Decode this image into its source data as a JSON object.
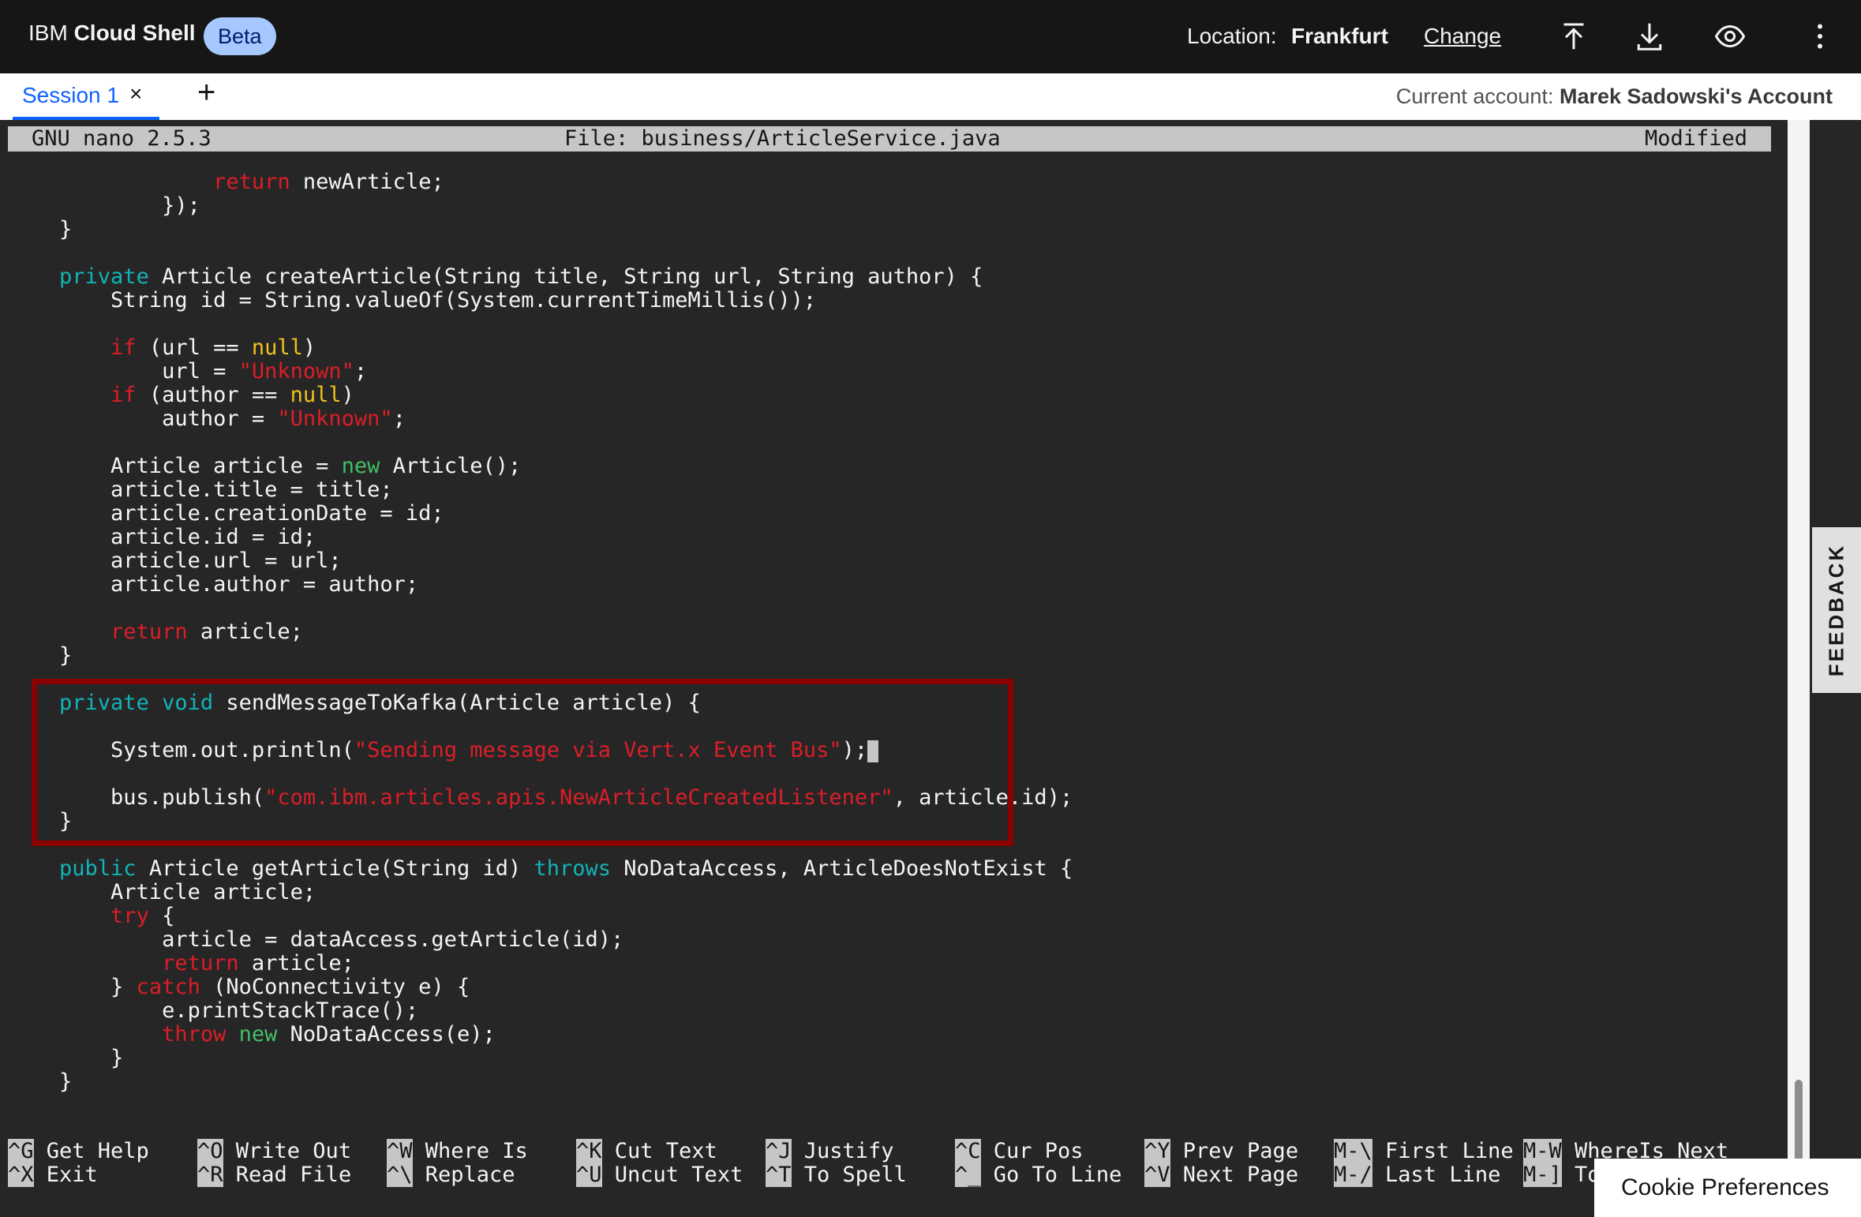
{
  "header": {
    "brand_prefix": "IBM",
    "brand_name": "Cloud Shell",
    "beta_badge": "Beta",
    "location_label": "Location:",
    "location_value": "Frankfurt",
    "change_link": "Change",
    "icons": [
      "upload-icon",
      "download-icon",
      "preview-eye-icon",
      "overflow-menu-icon"
    ]
  },
  "tabs": {
    "session_label": "Session 1",
    "close_glyph": "×",
    "add_glyph": "+",
    "account_label": "Current account:",
    "account_name": "Marek Sadowski's Account"
  },
  "nano": {
    "version": "GNU nano 2.5.3",
    "file": "File: business/ArticleService.java",
    "status": "Modified"
  },
  "code_lines": [
    "                return newArticle;",
    "            });",
    "    }",
    "",
    "    private Article createArticle(String title, String url, String author) {",
    "        String id = String.valueOf(System.currentTimeMillis());",
    "",
    "        if (url == null)",
    "            url = \"Unknown\";",
    "        if (author == null)",
    "            author = \"Unknown\";",
    "",
    "        Article article = new Article();",
    "        article.title = title;",
    "        article.creationDate = id;",
    "        article.id = id;",
    "        article.url = url;",
    "        article.author = author;",
    "",
    "        return article;",
    "    }",
    "",
    "    private void sendMessageToKafka(Article article) {",
    "",
    "        System.out.println(\"Sending message via Vert.x Event Bus\");",
    "",
    "        bus.publish(\"com.ibm.articles.apis.NewArticleCreatedListener\", article.id);",
    "    }",
    "",
    "    public Article getArticle(String id) throws NoDataAccess, ArticleDoesNotExist {",
    "        Article article;",
    "        try {",
    "            article = dataAccess.getArticle(id);",
    "            return article;",
    "        } catch (NoConnectivity e) {",
    "            e.printStackTrace();",
    "            throw new NoDataAccess(e);",
    "        }",
    "    }"
  ],
  "shortcuts": [
    {
      "k1": "^G",
      "l1": "Get Help",
      "k2": "^X",
      "l2": "Exit"
    },
    {
      "k1": "^O",
      "l1": "Write Out",
      "k2": "^R",
      "l2": "Read File"
    },
    {
      "k1": "^W",
      "l1": "Where Is",
      "k2": "^\\",
      "l2": "Replace"
    },
    {
      "k1": "^K",
      "l1": "Cut Text",
      "k2": "^U",
      "l2": "Uncut Text"
    },
    {
      "k1": "^J",
      "l1": "Justify",
      "k2": "^T",
      "l2": "To Spell"
    },
    {
      "k1": "^C",
      "l1": "Cur Pos",
      "k2": "^_",
      "l2": "Go To Line"
    },
    {
      "k1": "^Y",
      "l1": "Prev Page",
      "k2": "^V",
      "l2": "Next Page"
    },
    {
      "k1": "M-\\",
      "l1": "First Line",
      "k2": "M-/",
      "l2": "Last Line"
    },
    {
      "k1": "M-W",
      "l1": "WhereIs Next",
      "k2": "M-]",
      "l2": "To"
    }
  ],
  "feedback_label": "FEEDBACK",
  "cookie_label": "Cookie Preferences",
  "colors": {
    "keyword_teal": "#12b3b8",
    "keyword_red": "#da1e28",
    "null_yellow": "#f1c21b",
    "new_green": "#42be65",
    "highlight_border": "#8b0000",
    "accent_blue": "#0f62fe"
  }
}
